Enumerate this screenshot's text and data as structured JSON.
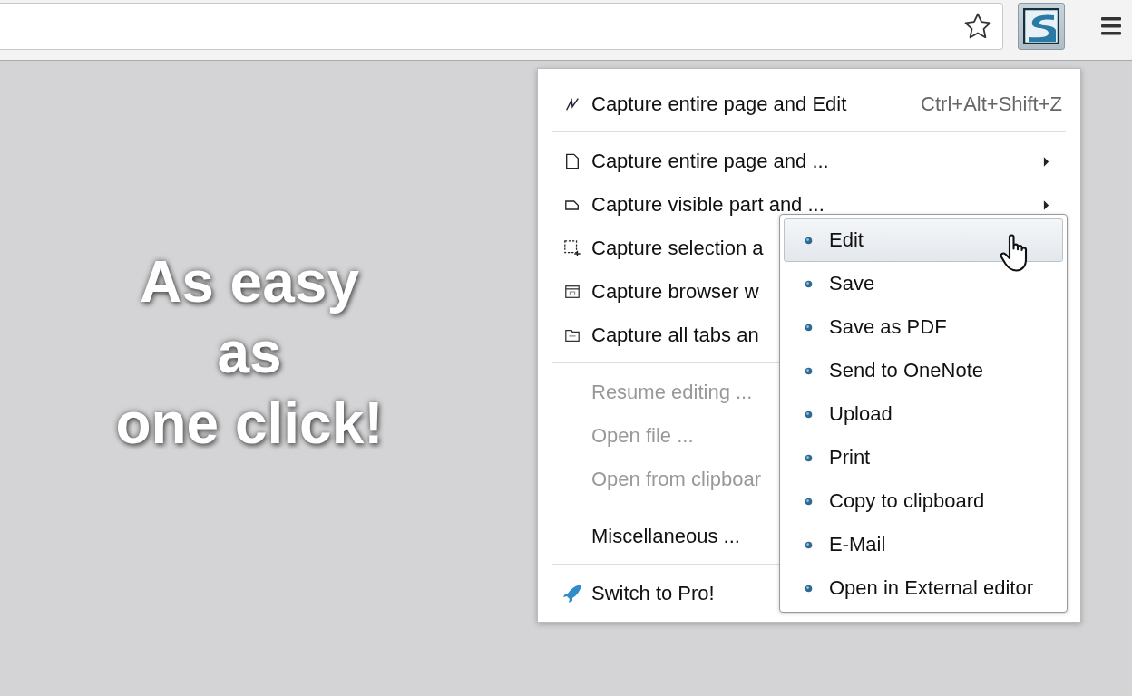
{
  "tagline": [
    "As easy",
    "as",
    "one click!"
  ],
  "menu": {
    "groups": [
      [
        {
          "label": "Capture entire page and Edit",
          "shortcut": "Ctrl+Alt+Shift+Z",
          "has_submenu": false,
          "disabled": false
        }
      ],
      [
        {
          "label": "Capture entire page and ...",
          "has_submenu": true,
          "disabled": false
        },
        {
          "label": "Capture visible part and ...",
          "has_submenu": true,
          "disabled": false
        },
        {
          "label": "Capture selection a",
          "disabled": false
        },
        {
          "label": "Capture browser w",
          "disabled": false
        },
        {
          "label": "Capture all tabs an",
          "disabled": false
        }
      ],
      [
        {
          "label": "Resume editing ...",
          "disabled": true
        },
        {
          "label": "Open file ...",
          "disabled": true
        },
        {
          "label": "Open from clipboar",
          "disabled": true
        }
      ],
      [
        {
          "label": "Miscellaneous ...",
          "disabled": false
        }
      ],
      [
        {
          "label": "Switch to Pro!",
          "disabled": false
        }
      ]
    ]
  },
  "submenu": {
    "items": [
      {
        "label": "Edit",
        "selected": true
      },
      {
        "label": "Save",
        "selected": false
      },
      {
        "label": "Save as PDF",
        "selected": false
      },
      {
        "label": "Send to OneNote",
        "selected": false
      },
      {
        "label": "Upload",
        "selected": false
      },
      {
        "label": "Print",
        "selected": false
      },
      {
        "label": "Copy to clipboard",
        "selected": false
      },
      {
        "label": "E-Mail",
        "selected": false
      },
      {
        "label": "Open in External editor",
        "selected": false
      }
    ]
  }
}
